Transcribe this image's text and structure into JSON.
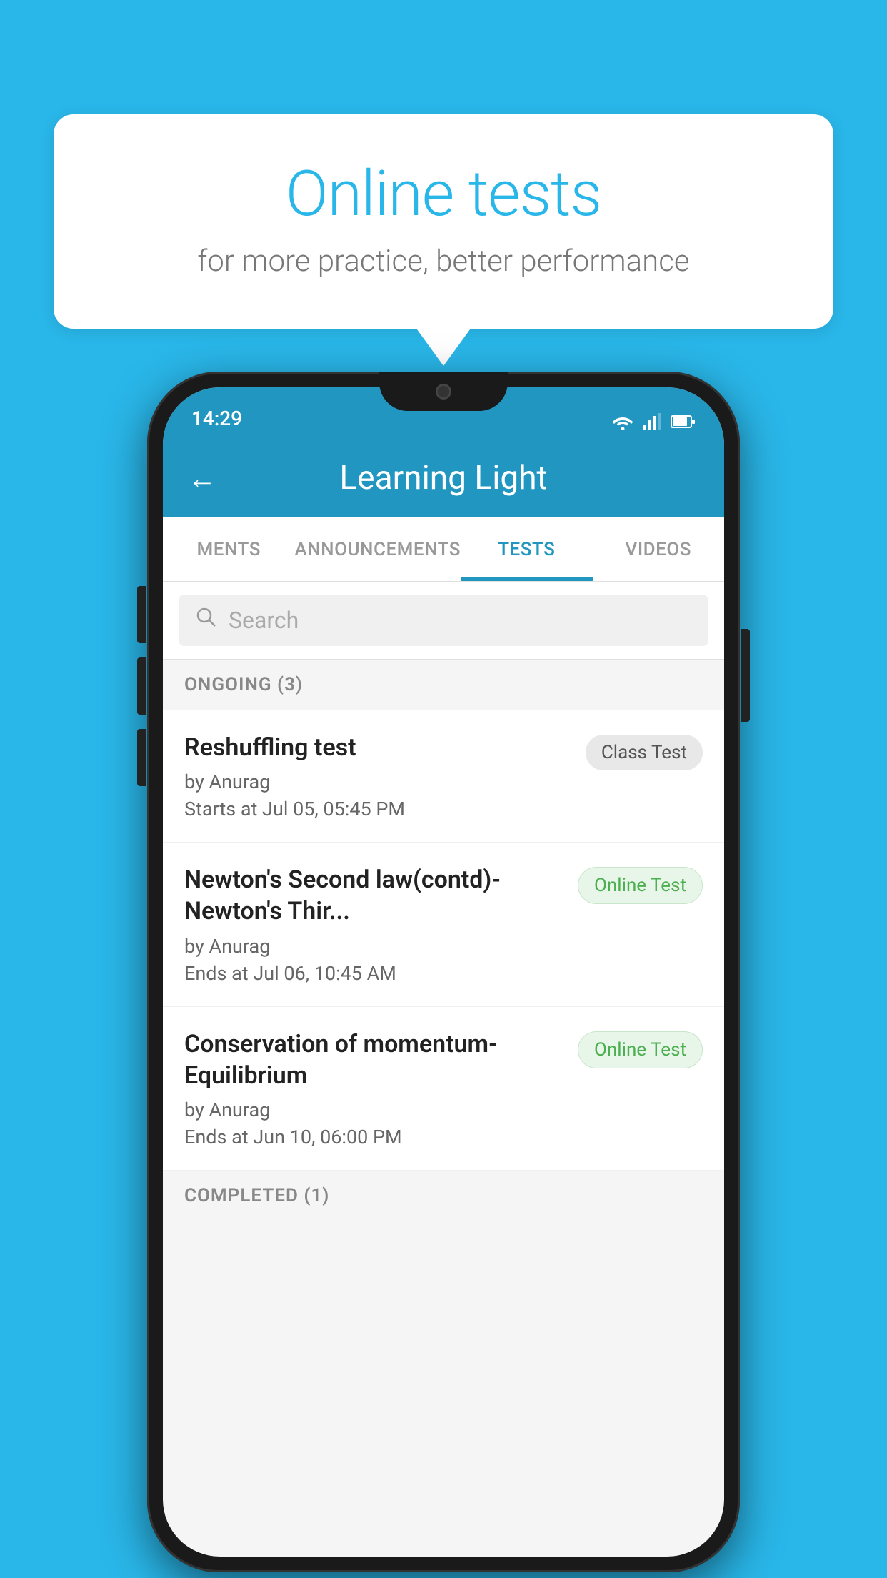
{
  "background_color": "#29B6E8",
  "bubble": {
    "title": "Online tests",
    "subtitle": "for more practice, better performance"
  },
  "phone": {
    "status_bar": {
      "time": "14:29"
    },
    "app_bar": {
      "title": "Learning Light"
    },
    "tabs": [
      {
        "label": "MENTS",
        "active": false
      },
      {
        "label": "ANNOUNCEMENTS",
        "active": false
      },
      {
        "label": "TESTS",
        "active": true
      },
      {
        "label": "VIDEOS",
        "active": false
      }
    ],
    "search": {
      "placeholder": "Search"
    },
    "ongoing_section": {
      "label": "ONGOING (3)"
    },
    "tests": [
      {
        "title": "Reshuffling test",
        "author": "by Anurag",
        "time": "Starts at  Jul 05, 05:45 PM",
        "badge": "Class Test",
        "badge_type": "class"
      },
      {
        "title": "Newton's Second law(contd)-Newton's Thir...",
        "author": "by Anurag",
        "time": "Ends at  Jul 06, 10:45 AM",
        "badge": "Online Test",
        "badge_type": "online"
      },
      {
        "title": "Conservation of momentum-Equilibrium",
        "author": "by Anurag",
        "time": "Ends at  Jun 10, 06:00 PM",
        "badge": "Online Test",
        "badge_type": "online"
      }
    ],
    "completed_section": {
      "label": "COMPLETED (1)"
    }
  }
}
